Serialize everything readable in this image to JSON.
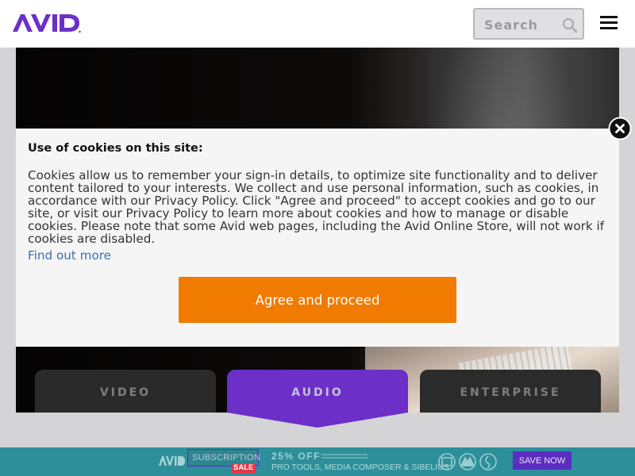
{
  "header": {
    "logo_text": "AVID",
    "search": {
      "placeholder": "Search"
    }
  },
  "icons": {
    "search": "magnifier-icon",
    "menu": "hamburger-icon",
    "close": "close-circle-icon"
  },
  "hero": {
    "tabs": [
      {
        "label": "VIDEO",
        "active": false
      },
      {
        "label": "AUDIO",
        "active": true
      },
      {
        "label": "ENTERPRISE",
        "active": false
      }
    ]
  },
  "cookie": {
    "title": "Use of cookies on this site:",
    "body": "Cookies allow us to remember your sign-in details, to optimize site functionality and to deliver content tailored to your interests. We collect and use personal information, such as cookies, in accordance with our Privacy Policy. Click \"Agree and proceed\" to accept cookies and go to our site, or visit our Privacy Policy to learn more about cookies and how to manage or disable cookies. Please note that some Avid web pages, including the Avid Online Store, will not work if cookies are disabled.",
    "find_out_more": "Find out more",
    "agree_label": "Agree and proceed"
  },
  "promo": {
    "logo_text": "AVID",
    "subscription": "SUBSCRIPTION",
    "sale": "SALE",
    "discount": "25% OFF",
    "products": "PRO TOOLS, MEDIA COMPOSER & SIBELIUS",
    "cta": "SAVE NOW"
  },
  "colors": {
    "brand_purple": "#6c2fc8",
    "accent_orange": "#f17a00",
    "link_blue": "#3a6fb0",
    "promo_teal": "#2d8f9a"
  }
}
